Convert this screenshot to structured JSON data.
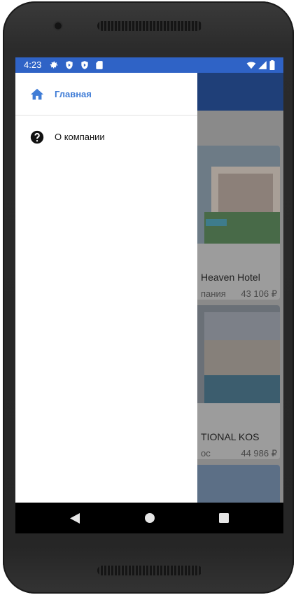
{
  "status_bar": {
    "time": "4:23",
    "icons_left": [
      "gear-icon",
      "shield-icon",
      "shield-icon",
      "sd-card-icon"
    ],
    "icons_right": [
      "wifi-icon",
      "signal-icon",
      "battery-icon"
    ],
    "color": "#2f63c6"
  },
  "drawer": {
    "items": [
      {
        "label": "Главная",
        "icon": "home-icon",
        "active": true
      },
      {
        "label": "О компании",
        "icon": "help-circle-icon",
        "active": false
      }
    ],
    "accent": "#3f7cd6"
  },
  "background_cards": [
    {
      "name": "Heaven Hotel",
      "location": "пания",
      "price": "43 106 ₽"
    },
    {
      "name": "TIONAL KOS",
      "location": "ос",
      "price": "44 986 ₽"
    }
  ],
  "system_nav": {
    "buttons": [
      "back-icon",
      "home-circle-icon",
      "recents-square-icon"
    ]
  }
}
